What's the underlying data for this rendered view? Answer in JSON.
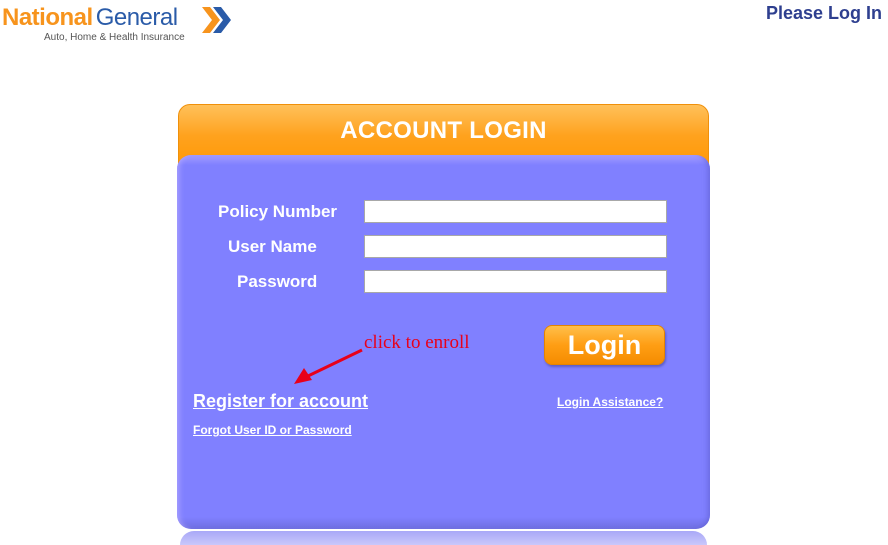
{
  "header": {
    "logo": {
      "brand_part1": "National",
      "brand_part2": "General",
      "tagline": "Auto, Home & Health Insurance",
      "icon": "double-chevron-right-icon",
      "colors": {
        "orange": "#f7941d",
        "blue": "#2a5ba8"
      }
    },
    "status_text": "Please Log In"
  },
  "login_panel": {
    "title": "ACCOUNT LOGIN",
    "fields": [
      {
        "label": "Policy Number",
        "value": "",
        "placeholder": ""
      },
      {
        "label": "User Name",
        "value": "",
        "placeholder": ""
      },
      {
        "label": "Password",
        "value": "",
        "placeholder": ""
      }
    ],
    "login_button": "Login",
    "annotation": "click to enroll",
    "links": {
      "register": "Register for account",
      "forgot": "Forgot User ID or Password",
      "assistance": "Login Assistance?"
    },
    "colors": {
      "panel": "#8080ff",
      "header": "#ffa21e",
      "annotation": "#e8001a"
    }
  }
}
